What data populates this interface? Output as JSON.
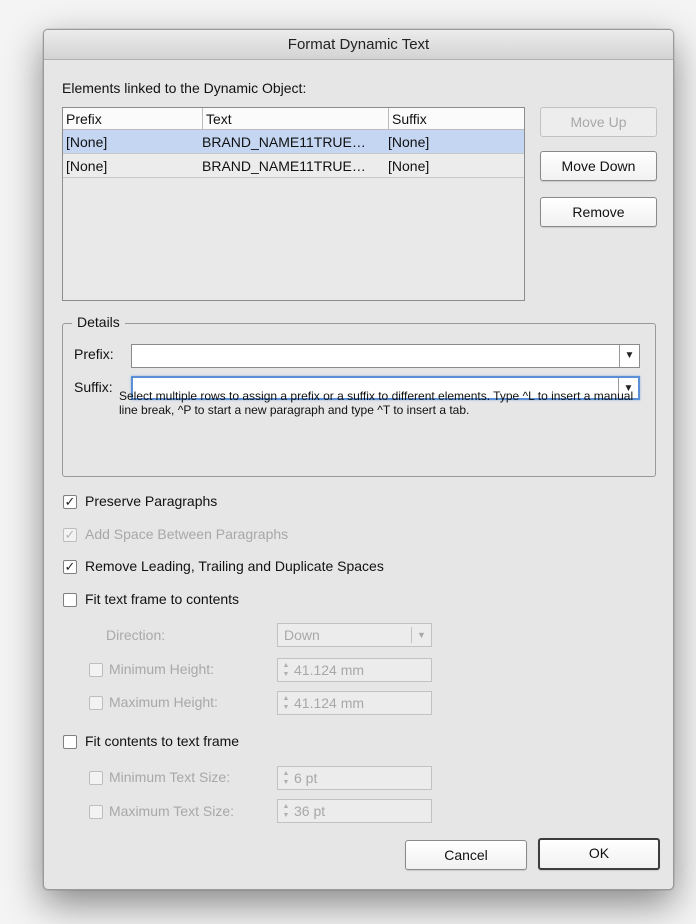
{
  "dialog": {
    "title": "Format Dynamic Text"
  },
  "elements": {
    "label": "Elements linked to the Dynamic Object:",
    "columns": [
      "Prefix",
      "Text",
      "Suffix"
    ],
    "rows": [
      {
        "prefix": "[None]",
        "text": "BRAND_NAME11TRUE…",
        "suffix": "[None]",
        "selected": true
      },
      {
        "prefix": "[None]",
        "text": "BRAND_NAME11TRUE…",
        "suffix": "[None]",
        "selected": false
      }
    ]
  },
  "buttons": {
    "move_up": "Move Up",
    "move_down": "Move Down",
    "remove": "Remove",
    "cancel": "Cancel",
    "ok": "OK"
  },
  "details": {
    "legend": "Details",
    "prefix_label": "Prefix:",
    "prefix_value": "",
    "suffix_label": "Suffix:",
    "suffix_value": "",
    "help": "Select multiple rows to assign a prefix or a suffix to different elements. Type ^L to insert a manual line break, ^P to start a new paragraph and type ^T to insert a tab."
  },
  "options": {
    "preserve_paragraphs": {
      "label": "Preserve Paragraphs",
      "checked": true,
      "enabled": true
    },
    "add_space": {
      "label": "Add Space Between Paragraphs",
      "checked": true,
      "enabled": false
    },
    "remove_spaces": {
      "label": "Remove Leading, Trailing and Duplicate Spaces",
      "checked": true,
      "enabled": true
    },
    "fit_frame": {
      "label": "Fit text frame to contents",
      "checked": false,
      "enabled": true
    },
    "direction_label": "Direction:",
    "direction_value": "Down",
    "min_height": {
      "label": "Minimum Height:",
      "value": "41.124 mm",
      "checked": false,
      "enabled": false
    },
    "max_height": {
      "label": "Maximum Height:",
      "value": "41.124 mm",
      "checked": false,
      "enabled": false
    },
    "fit_contents": {
      "label": "Fit contents to text frame",
      "checked": false,
      "enabled": true
    },
    "min_text": {
      "label": "Minimum Text Size:",
      "value": "6 pt",
      "checked": false,
      "enabled": false
    },
    "max_text": {
      "label": "Maximum Text Size:",
      "value": "36 pt",
      "checked": false,
      "enabled": false
    }
  },
  "icons": {
    "check": "checkmark-icon",
    "dropdown": "chevron-down-icon",
    "stepper": "stepper-icon"
  }
}
